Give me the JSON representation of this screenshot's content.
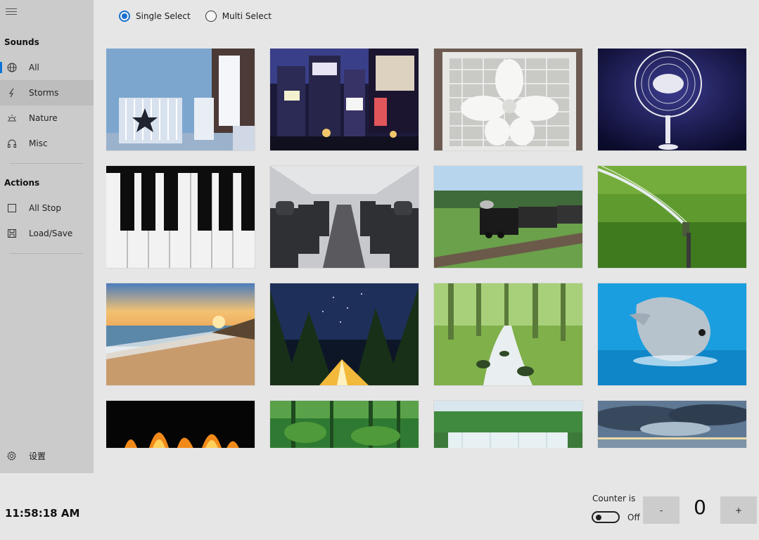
{
  "sidebar": {
    "sounds_title": "Sounds",
    "actions_title": "Actions",
    "sounds_items": [
      {
        "label": "All",
        "icon": "globe-icon"
      },
      {
        "label": "Storms",
        "icon": "lightning-icon"
      },
      {
        "label": "Nature",
        "icon": "sunrise-icon"
      },
      {
        "label": "Misc",
        "icon": "headphones-icon"
      }
    ],
    "actions_items": [
      {
        "label": "All Stop",
        "icon": "checkbox-icon"
      },
      {
        "label": "Load/Save",
        "icon": "floppy-disk-icon"
      }
    ],
    "settings_label": "设置",
    "selected_item": "All",
    "accent_color": "#0a74d8"
  },
  "select_mode": {
    "single_label": "Single Select",
    "multi_label": "Multi Select",
    "selected": "Single Select"
  },
  "tiles": [
    {
      "scene": "nursery-room"
    },
    {
      "scene": "city-night-billboards"
    },
    {
      "scene": "box-fan"
    },
    {
      "scene": "pedestal-fan"
    },
    {
      "scene": "piano-keys"
    },
    {
      "scene": "airplane-cabin"
    },
    {
      "scene": "steam-train"
    },
    {
      "scene": "lawn-sprinkler"
    },
    {
      "scene": "beach-sunset"
    },
    {
      "scene": "night-camping-tent"
    },
    {
      "scene": "forest-stream"
    },
    {
      "scene": "dolphin"
    },
    {
      "scene": "fire"
    },
    {
      "scene": "rainforest"
    },
    {
      "scene": "waterfall"
    },
    {
      "scene": "stormy-sea"
    }
  ],
  "status": {
    "clock": "11:58:18 AM",
    "counter_label": "Counter is",
    "counter_state": "Off",
    "counter_value": "0",
    "minus_label": "-",
    "plus_label": "+"
  }
}
